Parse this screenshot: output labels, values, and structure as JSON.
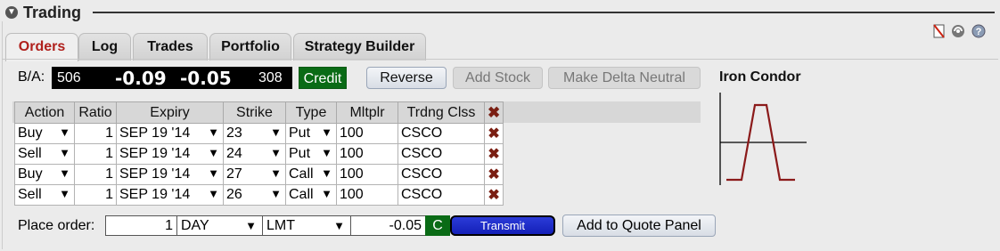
{
  "panel": {
    "title": "Trading",
    "collapse_icon": "chevron-down-icon"
  },
  "tabs": [
    {
      "label": "Orders",
      "active": true
    },
    {
      "label": "Log",
      "active": false
    },
    {
      "label": "Trades",
      "active": false
    },
    {
      "label": "Portfolio",
      "active": false
    },
    {
      "label": "Strategy Builder",
      "active": false
    }
  ],
  "toolbar_icons": [
    "detach-icon",
    "link-icon",
    "help-icon"
  ],
  "quote": {
    "label": "B/A:",
    "bid_size": "506",
    "bid": "-0.09",
    "ask": "-0.05",
    "ask_size": "308",
    "credit_label": "Credit"
  },
  "buttons": {
    "reverse": "Reverse",
    "add_stock": "Add Stock",
    "make_delta_neutral": "Make Delta Neutral"
  },
  "strategy": {
    "name": "Iron Condor"
  },
  "legs_table": {
    "columns": [
      "Action",
      "Ratio",
      "Expiry",
      "Strike",
      "Type",
      "Mltplr",
      "Trdng Clss"
    ],
    "rows": [
      {
        "action": "Buy",
        "ratio": "1",
        "expiry": "SEP 19 '14",
        "strike": "23",
        "type": "Put",
        "mltplr": "100",
        "trdng_clss": "CSCO"
      },
      {
        "action": "Sell",
        "ratio": "1",
        "expiry": "SEP 19 '14",
        "strike": "24",
        "type": "Put",
        "mltplr": "100",
        "trdng_clss": "CSCO"
      },
      {
        "action": "Buy",
        "ratio": "1",
        "expiry": "SEP 19 '14",
        "strike": "27",
        "type": "Call",
        "mltplr": "100",
        "trdng_clss": "CSCO"
      },
      {
        "action": "Sell",
        "ratio": "1",
        "expiry": "SEP 19 '14",
        "strike": "26",
        "type": "Call",
        "mltplr": "100",
        "trdng_clss": "CSCO"
      }
    ]
  },
  "order": {
    "label": "Place order:",
    "quantity": "1",
    "tif": "DAY",
    "order_type": "LMT",
    "price": "-0.05",
    "c_label": "C",
    "transmit": "Transmit",
    "add_to_quote_panel": "Add to Quote Panel"
  },
  "colors": {
    "active_tab": "#b0201c",
    "credit_bg": "#0a6b16",
    "transmit_bg": "#1420b8",
    "payoff_line": "#8b1a1a"
  }
}
